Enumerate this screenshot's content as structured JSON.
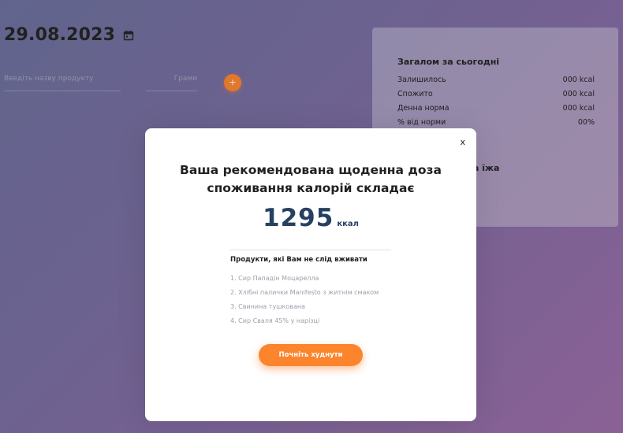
{
  "diary": {
    "date": "29.08.2023",
    "product_placeholder": "Введіть назву продукту",
    "grams_placeholder": "Грами",
    "add_label": "+"
  },
  "summary": {
    "title": "Загалом за сьогодні",
    "rows": [
      {
        "label": "Залишилось",
        "value": "000 kcal"
      },
      {
        "label": "Спожито",
        "value": "000 kcal"
      },
      {
        "label": "Денна норма",
        "value": "000 kcal"
      },
      {
        "label": "% від норми",
        "value": "00%"
      }
    ],
    "second_title_visible": "а їжа"
  },
  "modal": {
    "close_label": "x",
    "title_line1": "Ваша рекомендована щоденна доза",
    "title_line2": "споживання калорій складає",
    "kcal_value": "1295",
    "kcal_unit": "ккал",
    "list_title": "Продукти, які Вам не слід вживати",
    "foods": [
      "1. Сир Пападін Моцарелла",
      "2. Хлібні палички Manifesto з житнім смаком",
      "3. Свинина тушкована",
      "4. Сир Сваля 45% у нарізці"
    ],
    "cta_label": "Почніть худнути"
  },
  "colors": {
    "accent": "#fc842d",
    "kcal_text": "#264061"
  }
}
